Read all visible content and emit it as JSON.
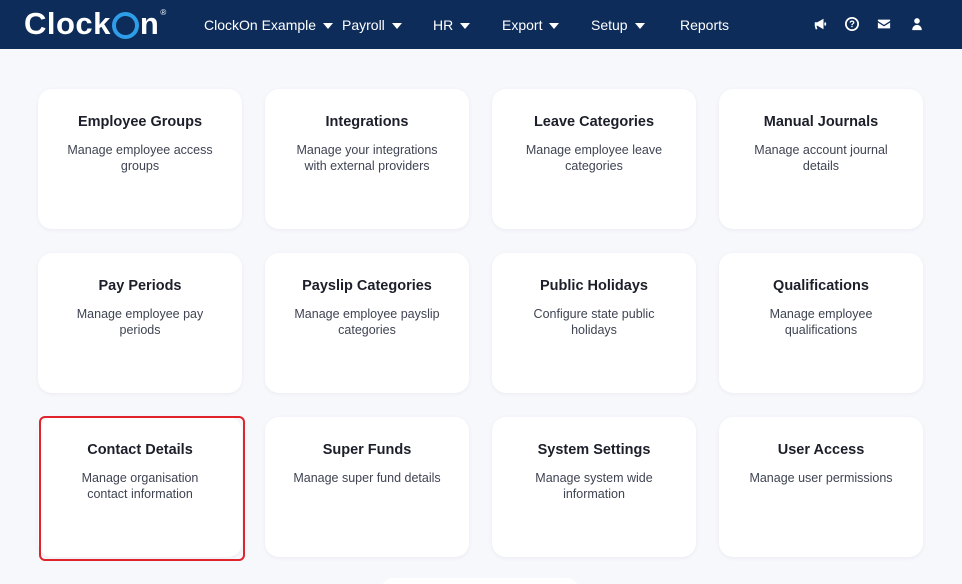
{
  "brand": {
    "logo_text_1": "Clock",
    "logo_text_2": "n",
    "trademark": "®"
  },
  "nav": {
    "items": [
      {
        "label": "ClockOn Example",
        "dropdown": true
      },
      {
        "label": "Payroll",
        "dropdown": true
      },
      {
        "label": "HR",
        "dropdown": true
      },
      {
        "label": "Export",
        "dropdown": true
      },
      {
        "label": "Setup",
        "dropdown": true
      },
      {
        "label": "Reports",
        "dropdown": false
      }
    ],
    "icons": [
      "megaphone-icon",
      "help-icon",
      "mail-icon",
      "user-icon"
    ]
  },
  "cards": [
    {
      "title": "Employee Groups",
      "desc": "Manage employee access groups"
    },
    {
      "title": "Integrations",
      "desc": "Manage your integrations with external providers"
    },
    {
      "title": "Leave Categories",
      "desc": "Manage employee leave categories"
    },
    {
      "title": "Manual Journals",
      "desc": "Manage account journal details"
    },
    {
      "title": "Pay Periods",
      "desc": "Manage employee pay periods"
    },
    {
      "title": "Payslip Categories",
      "desc": "Manage employee payslip categories"
    },
    {
      "title": "Public Holidays",
      "desc": "Configure state public holidays"
    },
    {
      "title": "Qualifications",
      "desc": "Manage employee qualifications"
    },
    {
      "title": "Contact Details",
      "desc": "Manage organisation contact information"
    },
    {
      "title": "Super Funds",
      "desc": "Manage super fund details"
    },
    {
      "title": "System Settings",
      "desc": "Manage system wide information"
    },
    {
      "title": "User Access",
      "desc": "Manage user permissions"
    }
  ],
  "colors": {
    "navbar": "#0d2c5a",
    "accent": "#2f9ee8",
    "highlight": "#e0242b",
    "background": "#f7f8fc"
  }
}
